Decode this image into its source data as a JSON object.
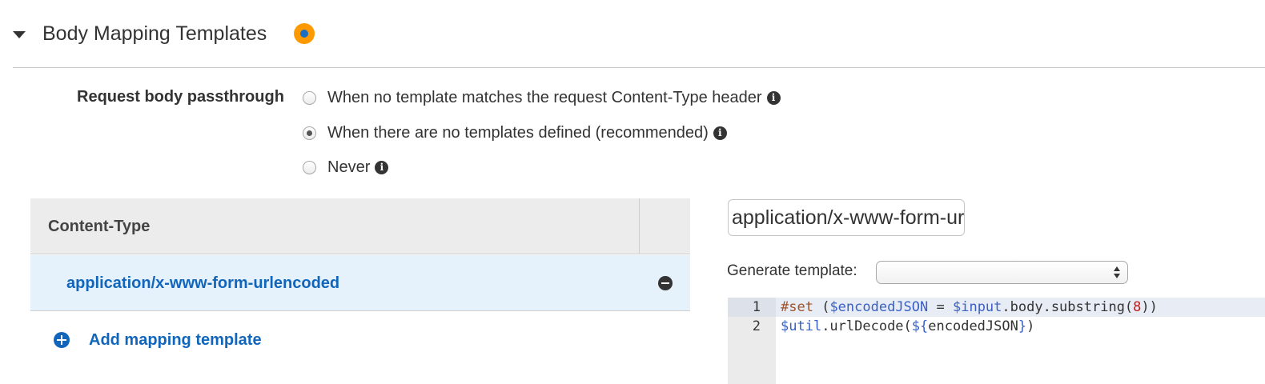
{
  "section": {
    "title": "Body Mapping Templates",
    "status_color": "#ff9900"
  },
  "passthrough": {
    "label": "Request body passthrough",
    "options": [
      {
        "label": "When no template matches the request Content-Type header",
        "selected": false,
        "icon": "info-icon"
      },
      {
        "label": "When there are no templates defined (recommended)",
        "selected": true,
        "icon": "info-icon"
      },
      {
        "label": "Never",
        "selected": false,
        "icon": "info-icon"
      }
    ]
  },
  "content_type_table": {
    "header": "Content-Type",
    "rows": [
      {
        "label": "application/x-www-form-urlencoded",
        "action_icon": "remove-icon"
      }
    ],
    "add_label": "Add mapping template"
  },
  "editor_panel": {
    "content_type_value": "application/x-www-form-urlencoded",
    "generate_label": "Generate template:",
    "generate_selected": ""
  },
  "code": {
    "lines": [
      {
        "number": "1",
        "tokens": [
          {
            "text": "#set",
            "kind": "kw"
          },
          {
            "text": " (",
            "kind": "plain"
          },
          {
            "text": "$encodedJSON",
            "kind": "var"
          },
          {
            "text": " = ",
            "kind": "plain"
          },
          {
            "text": "$input",
            "kind": "var"
          },
          {
            "text": ".body.substring(",
            "kind": "plain"
          },
          {
            "text": "8",
            "kind": "num"
          },
          {
            "text": "))",
            "kind": "plain"
          }
        ]
      },
      {
        "number": "2",
        "tokens": [
          {
            "text": "$util",
            "kind": "var"
          },
          {
            "text": ".urlDecode(",
            "kind": "plain"
          },
          {
            "text": "${",
            "kind": "var"
          },
          {
            "text": "encodedJSON",
            "kind": "plain"
          },
          {
            "text": "}",
            "kind": "var"
          },
          {
            "text": ")",
            "kind": "plain"
          }
        ]
      }
    ]
  },
  "colors": {
    "link": "#1166bb",
    "selected_row_bg": "#e5f1fb",
    "table_header_bg": "#ececec"
  }
}
